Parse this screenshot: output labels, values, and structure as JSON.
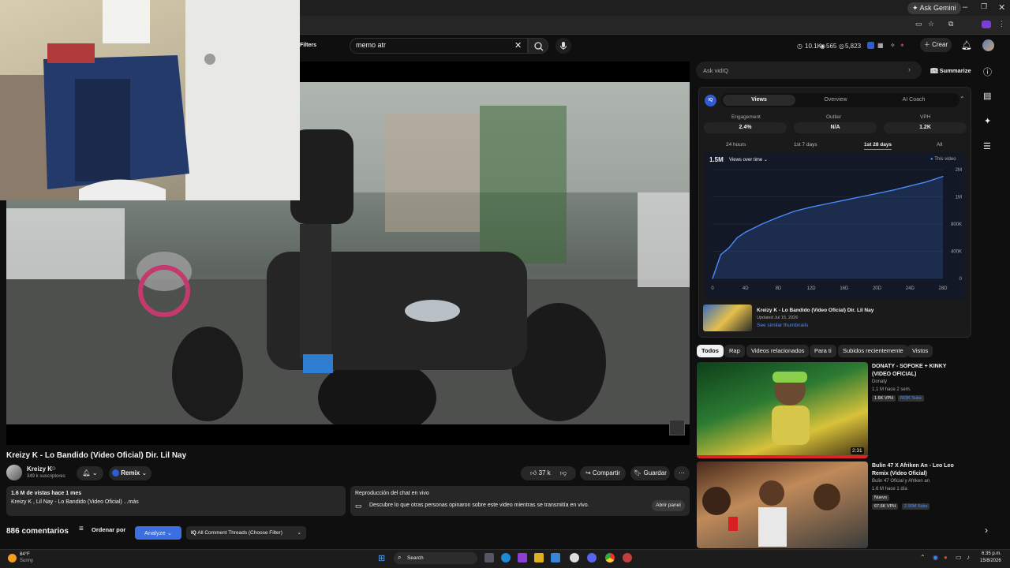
{
  "browser": {
    "ask_gemini": "Ask Gemini"
  },
  "yt_header": {
    "filters": "Filters",
    "search_value": "memo atr",
    "stats": [
      "10.1K",
      "565",
      "5,823"
    ],
    "create_label": "Crear"
  },
  "video": {
    "title": "Kreizy K - Lo Bandido (Video Oficial) Dir. Lil Nay",
    "channel_name": "Kreizy K",
    "subscribers": "349 k suscriptores",
    "remix_label": "Remix",
    "likes": "37 k",
    "share_label": "Compartir",
    "save_label": "Guardar",
    "views_meta": "1.6 M de vistas  hace 1 mes",
    "description": "Kreizy K , Lil Nay - Lo Bandido (Video Oficial) ...más",
    "chat_title": "Reproducción del chat en vivo",
    "chat_text": "Descubre lo que otras personas opinaron sobre este video mientras se transmitía en vivo.",
    "chat_button": "Abrir panel"
  },
  "comments": {
    "count": "886 comentarios",
    "sort_label": "Ordenar por",
    "analyze_label": "Analyze",
    "threads_label": "All Comment Threads (Choose Filter)"
  },
  "vidiq": {
    "ask_placeholder": "Ask vidIQ",
    "summarize": "Summarize",
    "logo": "IQ",
    "tabs": [
      "Views",
      "Overview",
      "AI Coach"
    ],
    "metrics": [
      {
        "label": "Engagement",
        "value": "2.4%"
      },
      {
        "label": "Outlier",
        "value": "N/A"
      },
      {
        "label": "VPH",
        "value": "1.2K"
      }
    ],
    "ranges": [
      "24 hours",
      "1st 7 days",
      "1st 28 days",
      "All"
    ],
    "total_views": "1.5M",
    "views_over_time": "Views over time",
    "legend": "This video",
    "video_title": "Kreizy K - Lo Bandido (Video Oficial) Dir. Lil Nay",
    "updated": "Updated Jul 15, 2026",
    "similar": "See similar thumbnails"
  },
  "chart_data": {
    "type": "line",
    "x_tick_labels": [
      "0",
      "4D",
      "8D",
      "12D",
      "16D",
      "20D",
      "24D",
      "28D"
    ],
    "y_tick_labels": [
      "0",
      "400K",
      "800K",
      "1M",
      "2M"
    ],
    "series": [
      {
        "name": "This video",
        "x": [
          0,
          1,
          2,
          3,
          4,
          6,
          8,
          10,
          12,
          14,
          16,
          18,
          20,
          22,
          24,
          26,
          28
        ],
        "y": [
          0,
          350000,
          450000,
          600000,
          680000,
          800000,
          900000,
          990000,
          1050000,
          1100000,
          1150000,
          1200000,
          1250000,
          1300000,
          1360000,
          1420000,
          1500000
        ]
      }
    ],
    "ylim": [
      0,
      1600000
    ],
    "xlim": [
      0,
      28
    ]
  },
  "chips": [
    "Todos",
    "Rap",
    "Videos relacionados",
    "Para ti",
    "Subidos recientemente",
    "Vistos"
  ],
  "recs": [
    {
      "title": "DONATY - SOFOKE + KINKY (VIDEO OFICIAL)",
      "channel": "Donaty",
      "meta": "1.1 M  hace 2 sem.",
      "badge1": "1.6K VPH",
      "badge2": "603K Subs",
      "duration": "2:31"
    },
    {
      "title": "Bulin 47 X Afriken An - Leo Leo Remix (Video Oficial)",
      "channel": "Bulin 47 Oficial  y Afriken an",
      "meta": "1.6 M  hace 1 día",
      "new_badge": "Nuevo",
      "badge1": "67.6K VPH",
      "badge2": "2.90M Subs"
    }
  ],
  "taskbar": {
    "temp": "84°F",
    "weather": "Sunny",
    "search": "Search",
    "time": "6:35 p.m.",
    "date": "15/8/2026"
  }
}
